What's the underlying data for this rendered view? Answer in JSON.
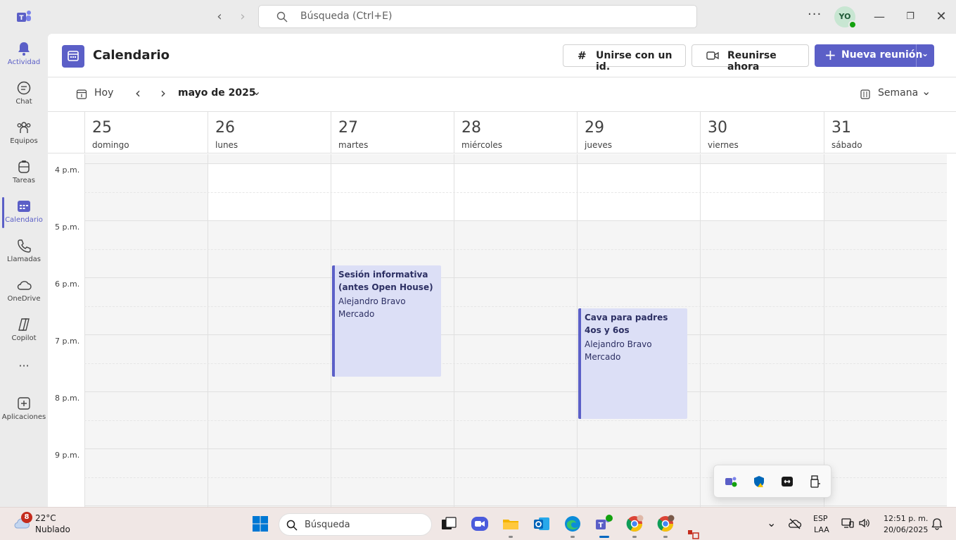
{
  "titlebar": {
    "search_placeholder": "Búsqueda (Ctrl+E)",
    "avatar_initials": "YO",
    "more_label": "···"
  },
  "rail": {
    "items": [
      {
        "label": "Actividad",
        "icon": "bell-icon",
        "active": false
      },
      {
        "label": "Chat",
        "icon": "chat-icon",
        "active": false
      },
      {
        "label": "Equipos",
        "icon": "teams-icon",
        "active": false
      },
      {
        "label": "Tareas",
        "icon": "tasks-icon",
        "active": false
      },
      {
        "label": "Calendario",
        "icon": "calendar-icon",
        "active": true
      },
      {
        "label": "Llamadas",
        "icon": "phone-icon",
        "active": false
      },
      {
        "label": "OneDrive",
        "icon": "cloud-icon",
        "active": false
      },
      {
        "label": "Copilot",
        "icon": "copilot-icon",
        "active": false
      },
      {
        "label": "···",
        "icon": "more-icon",
        "active": false
      },
      {
        "label": "Aplicaciones",
        "icon": "add-apps-icon",
        "active": false
      }
    ]
  },
  "header": {
    "title": "Calendario",
    "join_id_label": "Unirse con un id.",
    "meet_now_label": "Reunirse ahora",
    "new_meeting_label": "Nueva reunión"
  },
  "toolbar": {
    "today_label": "Hoy",
    "month_label": "mayo de 2025",
    "view_label": "Semana"
  },
  "days": [
    {
      "num": "25",
      "name": "domingo"
    },
    {
      "num": "26",
      "name": "lunes"
    },
    {
      "num": "27",
      "name": "martes"
    },
    {
      "num": "28",
      "name": "miércoles"
    },
    {
      "num": "29",
      "name": "jueves"
    },
    {
      "num": "30",
      "name": "viernes"
    },
    {
      "num": "31",
      "name": "sábado"
    }
  ],
  "hours": [
    "4 p.m.",
    "5 p.m.",
    "6 p.m.",
    "7 p.m.",
    "8 p.m.",
    "9 p.m."
  ],
  "events": [
    {
      "title": "Sesión informativa (antes Open House)",
      "organizer": "Alejandro Bravo Mercado",
      "day": "martes"
    },
    {
      "title": "Cava para padres 4os y 6os",
      "organizer": "Alejandro Bravo Mercado",
      "day": "jueves"
    }
  ],
  "taskbar": {
    "weather_temp": "22°C",
    "weather_desc": "Nublado",
    "weather_badge": "8",
    "search_label": "Búsqueda",
    "lang_1": "ESP",
    "lang_2": "LAA",
    "time": "12:51 p. m.",
    "date": "20/06/2025"
  },
  "colors": {
    "accent": "#5b5fc7",
    "event_bg": "#dcdff6",
    "presence": "#13a10e"
  }
}
